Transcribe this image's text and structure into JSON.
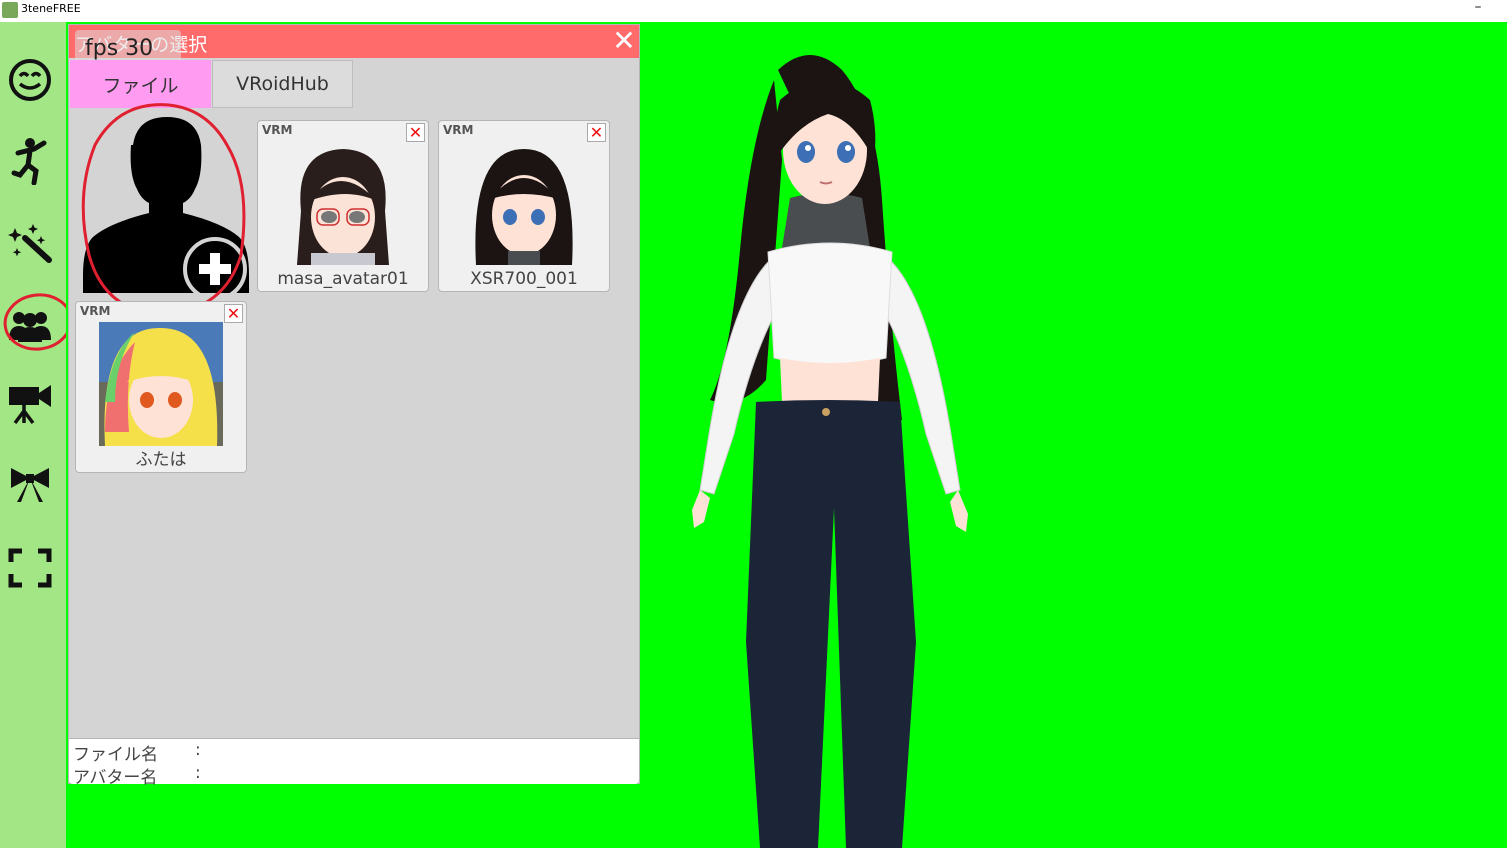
{
  "window": {
    "title": "3teneFREE",
    "minimize": "–"
  },
  "sidebar": {
    "items": [
      {
        "name": "face-icon"
      },
      {
        "name": "motion-icon"
      },
      {
        "name": "effects-icon"
      },
      {
        "name": "avatar-select-icon",
        "highlighted": true
      },
      {
        "name": "camera-icon"
      },
      {
        "name": "accessory-icon"
      },
      {
        "name": "fullscreen-icon"
      }
    ]
  },
  "panel": {
    "title": "アバターの選択",
    "fps": "fps 30",
    "close": "✕",
    "tabs": [
      {
        "label": "ファイル",
        "active": true
      },
      {
        "label": "VRoidHub",
        "active": false
      }
    ],
    "avatars": [
      {
        "badge": "VRM",
        "name": "masa_avatar01",
        "delete": "✕"
      },
      {
        "badge": "VRM",
        "name": "XSR700_001",
        "delete": "✕"
      },
      {
        "badge": "VRM",
        "name": "ふたは",
        "delete": "✕"
      }
    ],
    "info": {
      "file_label": "ファイル名",
      "avatar_label": "アバター名",
      "colon": ":"
    }
  },
  "colors": {
    "sidebar": "#a3e685",
    "stage": "#00ff00",
    "header": "#ff6b6b",
    "active_tab": "#ff9cf2",
    "annotation": "#e02030"
  }
}
